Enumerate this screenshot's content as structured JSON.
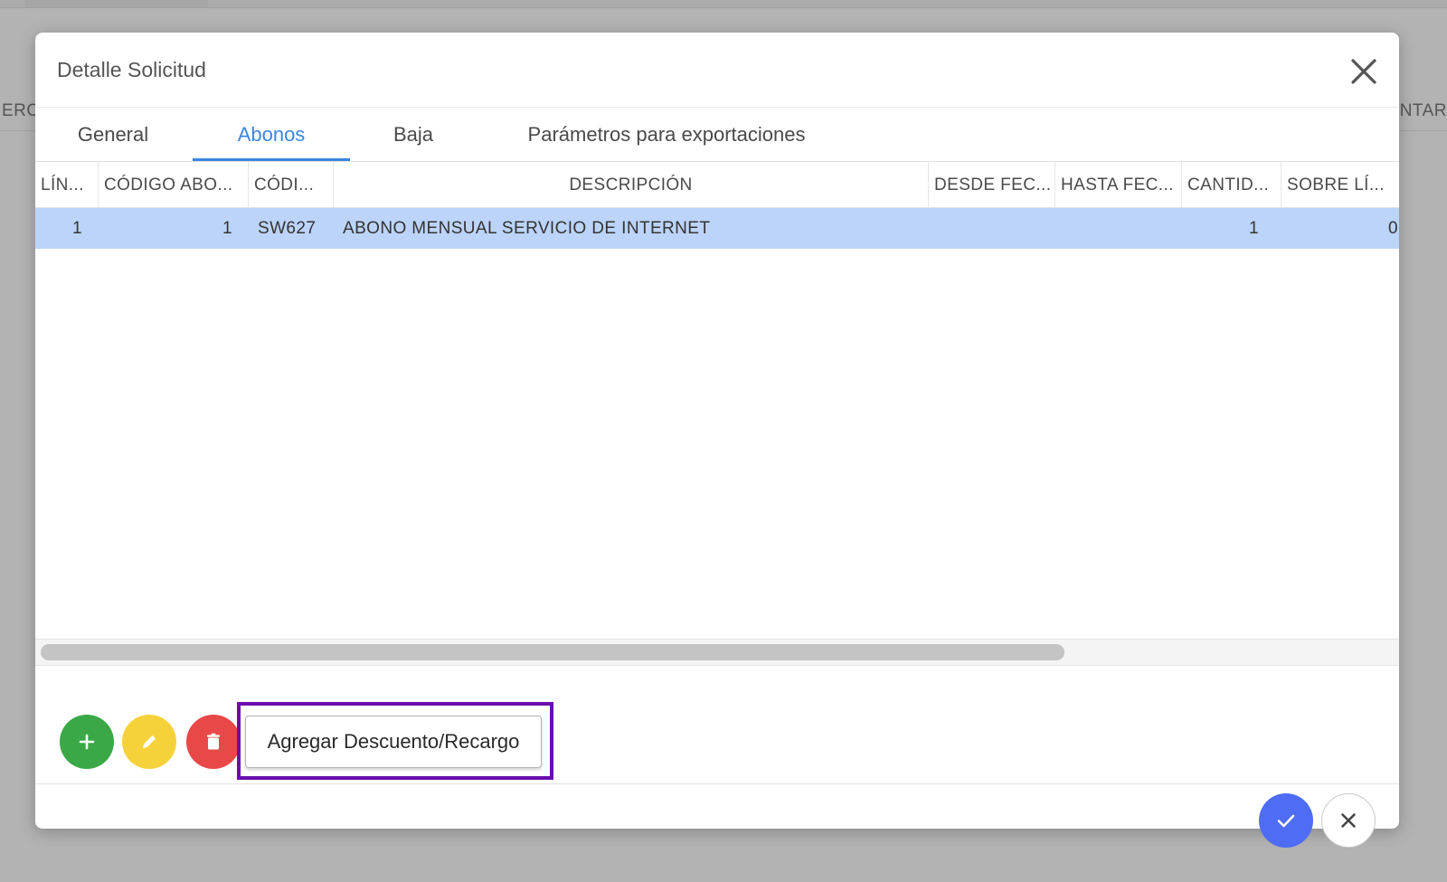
{
  "background": {
    "left_fragment": "ERO",
    "right_fragment": "NTAR"
  },
  "modal": {
    "title": "Detalle Solicitud",
    "tabs": [
      {
        "label": "General",
        "active": false
      },
      {
        "label": "Abonos",
        "active": true
      },
      {
        "label": "Baja",
        "active": false
      },
      {
        "label": "Parámetros para exportaciones",
        "active": false
      }
    ],
    "table": {
      "columns": [
        "LÍN...",
        "CÓDIGO ABO...",
        "CÓDI...",
        "DESCRIPCIÓN",
        "DESDE FEC...",
        "HASTA FEC...",
        "CANTID...",
        "SOBRE LÍ..."
      ],
      "rows": [
        {
          "linea": "1",
          "codigo_abono": "1",
          "codigo": "SW627",
          "descripcion": "ABONO MENSUAL SERVICIO DE INTERNET",
          "desde_fecha": "",
          "hasta_fecha": "",
          "cantidad": "1",
          "sobre_linea": "0",
          "selected": true
        }
      ]
    },
    "actions": {
      "add_icon": "plus-icon",
      "edit_icon": "pencil-icon",
      "delete_icon": "trash-icon",
      "discount_button_label": "Agregar Descuento/Recargo"
    },
    "footer": {
      "confirm_icon": "check-icon",
      "cancel_icon": "close-icon"
    }
  },
  "colors": {
    "accent": "#3a86e0",
    "selected_row": "#bcd4fa",
    "add": "#3aa847",
    "edit": "#f6d23a",
    "delete": "#e84848",
    "confirm": "#4f6cf5",
    "highlight": "#6a0dad"
  }
}
